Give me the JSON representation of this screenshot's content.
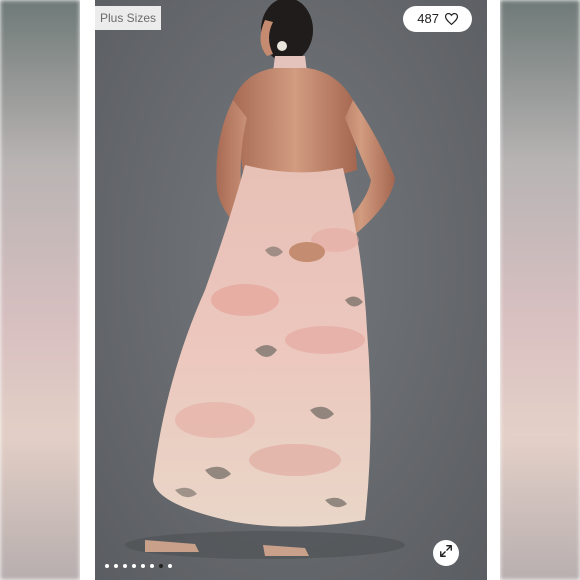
{
  "tag": {
    "label": "Plus Sizes"
  },
  "likes": {
    "count": "487",
    "icon": "heart-icon"
  },
  "carousel": {
    "total": 8,
    "active_index": 6
  },
  "expand": {
    "icon": "expand-arrows-icon"
  },
  "colors": {
    "background": "#6a6d71",
    "dress_pink": "#e8b3ad",
    "dress_cream": "#eee1d6",
    "dress_gray": "#6d6a65",
    "skin": "#c88f74"
  }
}
